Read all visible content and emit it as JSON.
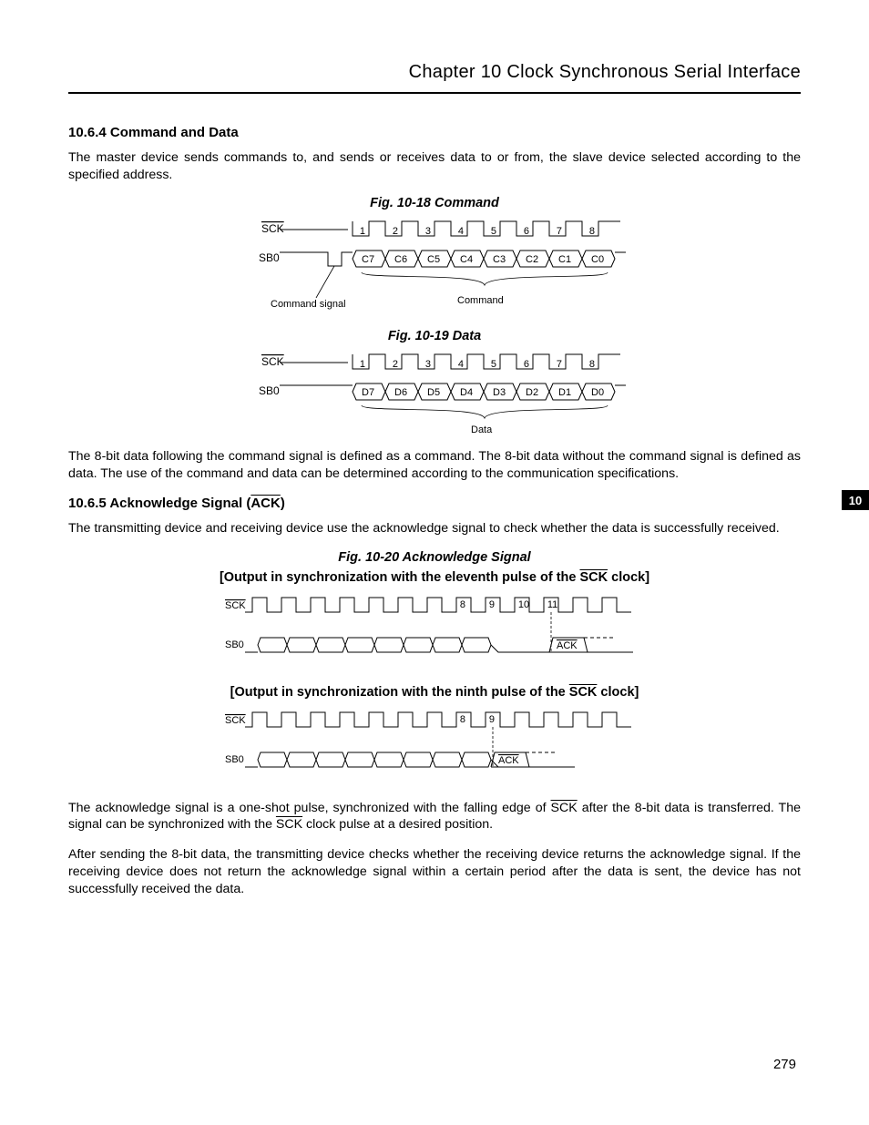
{
  "header": {
    "chapter": "Chapter 10   Clock Synchronous Serial Interface"
  },
  "sideTab": "10",
  "pageNo": "279",
  "s1": {
    "heading": "10.6.4  Command and Data",
    "p1": "The master device sends commands to, and sends or receives data to or from, the slave device selected according to the specified address.",
    "figA": "Fig. 10-18  Command",
    "figB": "Fig. 10-19  Data",
    "p2": "The 8-bit data following the command signal is defined as a command.  The 8-bit data without the command signal is defined as data.  The use of the command and data can be determined according to the communication specifications."
  },
  "s2": {
    "heading_pre": "10.6.5  Acknowledge Signal (",
    "heading_ack": "ACK",
    "heading_post": ")",
    "p1": "The transmitting device and receiving device use the acknowledge signal to check whether the data is successfully received.",
    "figC": "Fig. 10-20  Acknowledge Signal",
    "sub1_pre": "[Output in synchronization with the eleventh pulse of the ",
    "sub1_sck": "SCK",
    "sub1_post": " clock]",
    "sub2_pre": "[Output in synchronization with the ninth pulse of the ",
    "sub2_sck": "SCK",
    "sub2_post": " clock]",
    "p2_a": "The acknowledge signal is a one-shot pulse, synchronized with the falling edge of ",
    "p2_sck1": "SCK",
    "p2_b": " after the 8-bit data is transferred.  The signal can be synchronized with the ",
    "p2_sck2": "SCK",
    "p2_c": " clock pulse at a desired position.",
    "p3": "After sending the 8-bit data, the transmitting device checks whether the receiving device returns the acknowledge signal.  If the receiving device does not return the acknowledge signal within a certain period after the data is sent, the device has not successfully received the data."
  },
  "chart_data": [
    {
      "type": "timing",
      "title": "Fig. 10-18 Command",
      "signals": {
        "SCK": {
          "type": "clock",
          "pulses": [
            1,
            2,
            3,
            4,
            5,
            6,
            7,
            8
          ]
        },
        "SB0": {
          "type": "data",
          "pre_event": "Command signal (low pulse)",
          "bits": [
            "C7",
            "C6",
            "C5",
            "C4",
            "C3",
            "C2",
            "C1",
            "C0"
          ],
          "brace_label": "Command"
        }
      },
      "annotations": [
        "Command signal",
        "Command"
      ]
    },
    {
      "type": "timing",
      "title": "Fig. 10-19 Data",
      "signals": {
        "SCK": {
          "type": "clock",
          "pulses": [
            1,
            2,
            3,
            4,
            5,
            6,
            7,
            8
          ]
        },
        "SB0": {
          "type": "data",
          "bits": [
            "D7",
            "D6",
            "D5",
            "D4",
            "D3",
            "D2",
            "D1",
            "D0"
          ],
          "brace_label": "Data"
        }
      }
    },
    {
      "type": "timing",
      "title": "Fig. 10-20 Acknowledge Signal — eleventh pulse",
      "signals": {
        "SCK": {
          "type": "clock",
          "total_pulses": 13,
          "labeled": [
            8,
            9,
            10,
            11
          ]
        },
        "SB0": {
          "type": "data",
          "data_cells": 8,
          "idle_low": true,
          "ack_at_pulse": 11,
          "ack_label": "ACK"
        }
      }
    },
    {
      "type": "timing",
      "title": "Fig. 10-20 Acknowledge Signal — ninth pulse",
      "signals": {
        "SCK": {
          "type": "clock",
          "total_pulses": 13,
          "labeled": [
            8,
            9
          ]
        },
        "SB0": {
          "type": "data",
          "data_cells": 8,
          "idle_low": true,
          "ack_at_pulse": 9,
          "ack_label": "ACK"
        }
      }
    }
  ],
  "diagLabels": {
    "sck": "SCK",
    "sb0": "SB0",
    "cmdSig": "Command signal",
    "cmd": "Command",
    "data": "Data",
    "ack": "ACK",
    "clk8": [
      "1",
      "2",
      "3",
      "4",
      "5",
      "6",
      "7",
      "8"
    ],
    "cbits": [
      "C7",
      "C6",
      "C5",
      "C4",
      "C3",
      "C2",
      "C1",
      "C0"
    ],
    "dbits": [
      "D7",
      "D6",
      "D5",
      "D4",
      "D3",
      "D2",
      "D1",
      "D0"
    ],
    "p8": "8",
    "p9": "9",
    "p10": "10",
    "p11": "11"
  }
}
